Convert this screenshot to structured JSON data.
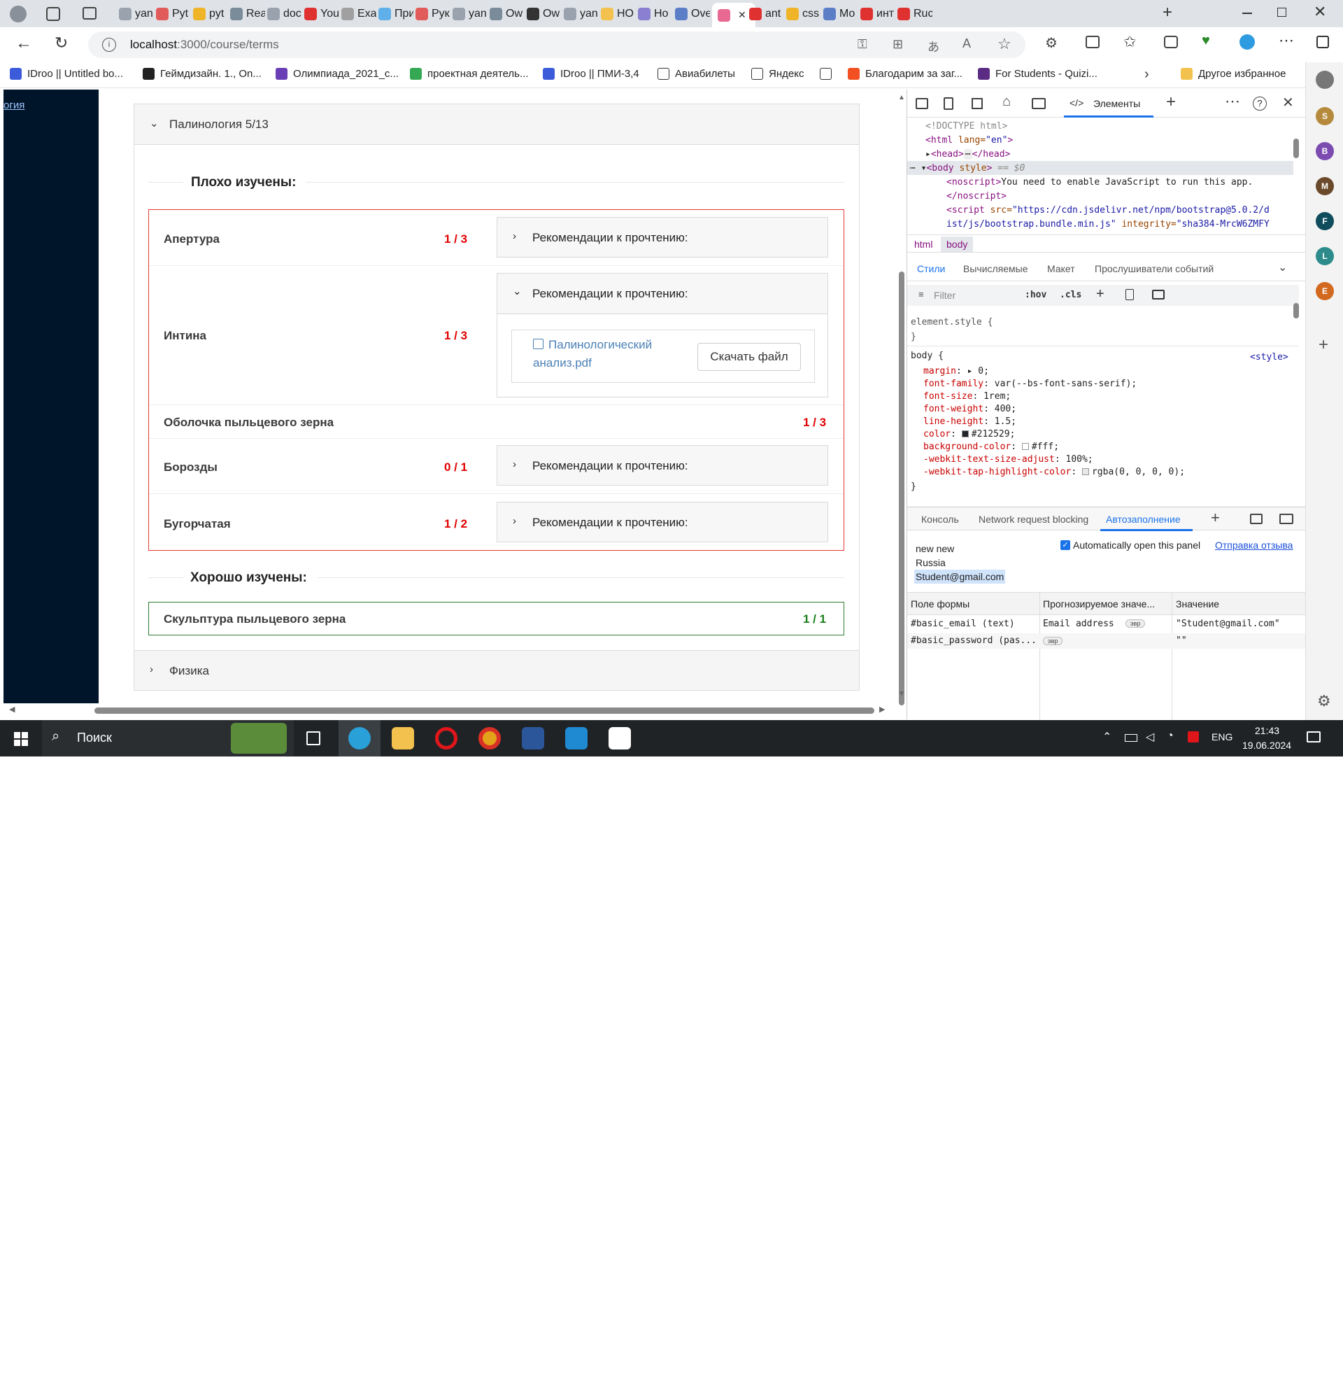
{
  "browser": {
    "tabs": [
      "yan",
      "Pyt",
      "pyt",
      "Rea",
      "doc",
      "You",
      "Exa",
      "При",
      "Рук",
      "yan",
      "Ow",
      "Ow",
      "yan",
      "НО",
      "Ho",
      "Ove",
      "",
      "ant",
      "css",
      "Mo",
      "инт",
      "Ruc"
    ],
    "url_host": "localhost",
    "url_path": ":3000/course/terms",
    "bookmarks": [
      "IDroo || Untitled bo...",
      "Геймдизайн. 1., On...",
      "Олимпиада_2021_с...",
      "проектная деятель...",
      "IDroo || ПМИ-3,4",
      "Авиабилеты",
      "Яндекс",
      "",
      "Благодарим за заг...",
      "For Students - Quizi..."
    ],
    "bookmarks_other": "Другое избранное"
  },
  "app": {
    "sidebar_link": "огия",
    "course_panel_title": "Палинология 5/13",
    "bad_section_title": "Плохо изучены:",
    "good_section_title": "Хорошо изучены:",
    "rec_label": "Рекомендации к прочтению:",
    "file_name_line1": "Палинологический",
    "file_name_line2": "анализ.pdf",
    "download_button": "Скачать файл",
    "bad_terms": [
      {
        "name": "Апертура",
        "score": "1 / 3"
      },
      {
        "name": "Интина",
        "score": "1 / 3"
      },
      {
        "name": "Оболочка пыльцевого зерна",
        "score": "1 / 3"
      },
      {
        "name": "Борозды",
        "score": "0 / 1"
      },
      {
        "name": "Бугорчатая",
        "score": "1 / 2"
      }
    ],
    "good_terms": [
      {
        "name": "Скульптура пыльцевого зерна",
        "score": "1 / 1"
      }
    ],
    "next_panel_title": "Физика"
  },
  "devtools": {
    "top_tab": "Элементы",
    "dom_lines": {
      "doctype": "<!DOCTYPE html>",
      "html_open": "<html",
      "html_attr": " lang=",
      "html_val": "\"en\"",
      "head": "<head>",
      "head_close": "</head>",
      "body": "<body",
      "body_attr": " style",
      "body_end": ">",
      "body_sel": " == $0",
      "noscript_open": "<noscript>",
      "noscript_text": "You need to enable JavaScript to run this app.",
      "noscript_close": "</noscript>",
      "script_open": "<script",
      "script_attr": " src=",
      "script_val1": "\"https://cdn.jsdelivr.net/npm/bootstrap@5.0.2/d",
      "script_val2": "ist/js/bootstrap.bundle.min.js\"",
      "script_integrity": " integrity=",
      "script_integrity_val": "\"sha384-MrcW6ZMFY"
    },
    "breadcrumb": [
      "html",
      "body"
    ],
    "style_tabs": [
      "Стили",
      "Вычисляемые",
      "Макет",
      "Прослушиватели событий"
    ],
    "filter_placeholder": "Filter",
    "hov": ":hov",
    "cls": ".cls",
    "element_style": "element.style {",
    "close_brace": "}",
    "body_rule": "body {",
    "style_source": "<style>",
    "props": [
      {
        "name": "margin",
        "value": "▸ 0;"
      },
      {
        "name": "font-family",
        "value": "var(--bs-font-sans-serif);"
      },
      {
        "name": "font-size",
        "value": "1rem;"
      },
      {
        "name": "font-weight",
        "value": "400;"
      },
      {
        "name": "line-height",
        "value": "1.5;"
      },
      {
        "name": "color",
        "value": "#212529;"
      },
      {
        "name": "background-color",
        "value": "#fff;"
      },
      {
        "name": "-webkit-text-size-adjust",
        "value": "100%;"
      },
      {
        "name": "-webkit-tap-highlight-color",
        "value": "rgba(0, 0, 0, 0);"
      }
    ],
    "drawer_tabs": [
      "Консоль",
      "Network request blocking",
      "Автозаполнение"
    ],
    "autofill_lines": [
      "new new",
      "Russia",
      "Student@gmail.com"
    ],
    "auto_open_label": "Automatically open this panel",
    "feedback_link": "Отправка отзыва",
    "table_headers": [
      "Поле формы",
      "Прогнозируемое значе...",
      "Значение"
    ],
    "table_rows": [
      {
        "field": "#basic_email (text)",
        "predicted": "Email address",
        "badge": "эвр",
        "value": "\"Student@gmail.com\""
      },
      {
        "field": "#basic_password (pas...",
        "predicted": "",
        "badge": "эвр",
        "value": "\"\""
      }
    ]
  },
  "sidebar_avatars": [
    "S",
    "B",
    "M",
    "F",
    "L",
    "E"
  ],
  "taskbar": {
    "search": "Поиск",
    "lang": "ENG",
    "time": "21:43",
    "date": "19.06.2024"
  },
  "colors": {
    "bad": "#e53935",
    "good": "#2e7d32",
    "dark_sidebar": "#001529",
    "devtools_accent": "#1a73e8"
  }
}
